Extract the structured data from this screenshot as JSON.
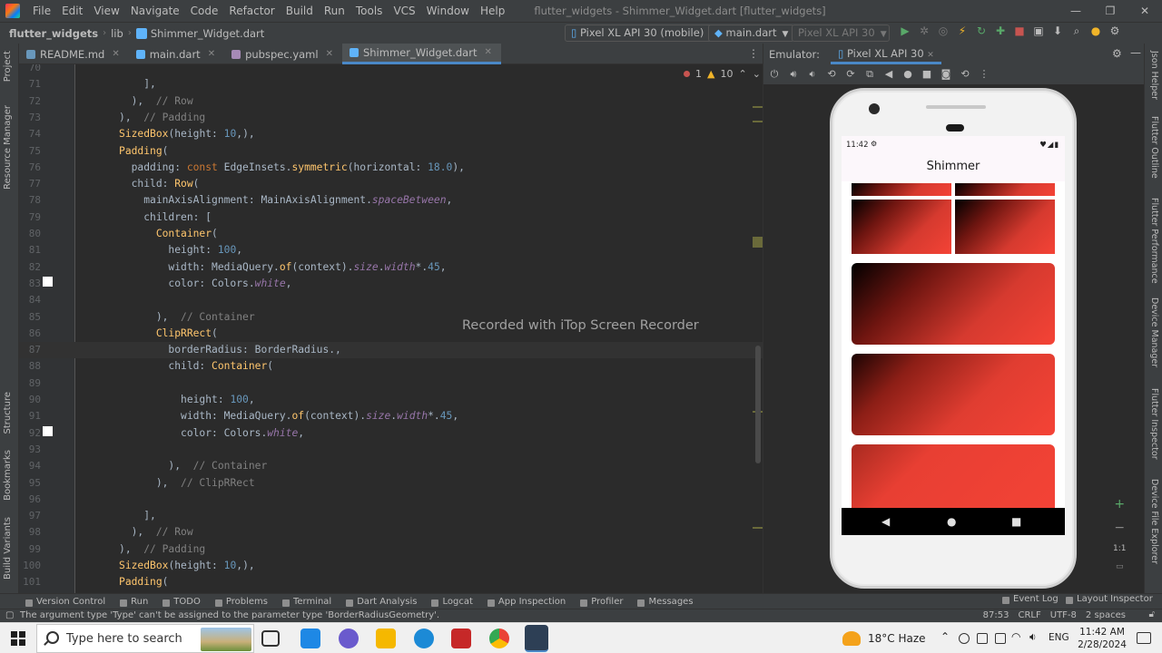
{
  "menubar": {
    "items": [
      "File",
      "Edit",
      "View",
      "Navigate",
      "Code",
      "Refactor",
      "Build",
      "Run",
      "Tools",
      "VCS",
      "Window",
      "Help"
    ],
    "window_title": "flutter_widgets - Shimmer_Widget.dart [flutter_widgets]"
  },
  "navbar": {
    "project": "flutter_widgets",
    "folder": "lib",
    "file": "Shimmer_Widget.dart",
    "device_combo": "Pixel XL API 30 (mobile)",
    "run_config": "main.dart",
    "running_device": "Pixel XL API 30"
  },
  "left_stripe": [
    "Project",
    "Resource Manager",
    "Structure",
    "Bookmarks",
    "Build Variants"
  ],
  "right_stripe": [
    "Json Helper",
    "Flutter Outline",
    "Flutter Performance",
    "Device Manager",
    "Flutter Inspector",
    "Device File Explorer"
  ],
  "editor_tabs": [
    {
      "label": "README.md",
      "color": "#6897bb"
    },
    {
      "label": "main.dart",
      "color": "#5fb3f9"
    },
    {
      "label": "pubspec.yaml",
      "color": "#a68ab6"
    },
    {
      "label": "Shimmer_Widget.dart",
      "color": "#5fb3f9"
    }
  ],
  "inspections": {
    "errors": "1",
    "warnings": "10"
  },
  "code_lines": [
    {
      "n": "70",
      "t": ""
    },
    {
      "n": "71",
      "t": "              ],"
    },
    {
      "n": "72",
      "t": "            ),  // Row"
    },
    {
      "n": "73",
      "t": "          ),  // Padding"
    },
    {
      "n": "74",
      "t": "          SizedBox(height: 10,),"
    },
    {
      "n": "75",
      "t": "          Padding("
    },
    {
      "n": "76",
      "t": "            padding: const EdgeInsets.symmetric(horizontal: 18.0),"
    },
    {
      "n": "77",
      "t": "            child: Row("
    },
    {
      "n": "78",
      "t": "              mainAxisAlignment: MainAxisAlignment.spaceBetween,"
    },
    {
      "n": "79",
      "t": "              children: ["
    },
    {
      "n": "80",
      "t": "                Container("
    },
    {
      "n": "81",
      "t": "                  height: 100,"
    },
    {
      "n": "82",
      "t": "                  width: MediaQuery.of(context).size.width*.45,"
    },
    {
      "n": "83",
      "t": "                  color: Colors.white,"
    },
    {
      "n": "84",
      "t": ""
    },
    {
      "n": "85",
      "t": "                ),  // Container"
    },
    {
      "n": "86",
      "t": "                ClipRRect("
    },
    {
      "n": "87",
      "t": "                  borderRadius: BorderRadius.,"
    },
    {
      "n": "88",
      "t": "                  child: Container("
    },
    {
      "n": "89",
      "t": ""
    },
    {
      "n": "90",
      "t": "                    height: 100,"
    },
    {
      "n": "91",
      "t": "                    width: MediaQuery.of(context).size.width*.45,"
    },
    {
      "n": "92",
      "t": "                    color: Colors.white,"
    },
    {
      "n": "93",
      "t": ""
    },
    {
      "n": "94",
      "t": "                  ),  // Container"
    },
    {
      "n": "95",
      "t": "                ),  // ClipRRect"
    },
    {
      "n": "96",
      "t": ""
    },
    {
      "n": "97",
      "t": "              ],"
    },
    {
      "n": "98",
      "t": "            ),  // Row"
    },
    {
      "n": "99",
      "t": "          ),  // Padding"
    },
    {
      "n": "100",
      "t": "          SizedBox(height: 10,),"
    },
    {
      "n": "101",
      "t": "          Padding("
    }
  ],
  "watermark": "Recorded with iTop Screen Recorder",
  "emulator": {
    "title": "Emulator:",
    "tab": "Pixel XL API 30",
    "zoom": "1:1",
    "status_time": "11:42",
    "app_title": "Shimmer",
    "gradient_colors": [
      "#000000",
      "#f44336"
    ]
  },
  "bottom_tools": [
    "Version Control",
    "Run",
    "TODO",
    "Problems",
    "Terminal",
    "Dart Analysis",
    "Logcat",
    "App Inspection",
    "Profiler",
    "Messages"
  ],
  "bottom_tools_right": [
    "Event Log",
    "Layout Inspector"
  ],
  "status": {
    "message": "The argument type 'Type' can't be assigned to the parameter type 'BorderRadiusGeometry'.",
    "position": "87:53",
    "line_sep": "CRLF",
    "encoding": "UTF-8",
    "indent": "2 spaces"
  },
  "taskbar": {
    "search_placeholder": "Type here to search",
    "weather": "18°C  Haze",
    "lang": "ENG",
    "time": "11:42 AM",
    "date": "2/28/2024"
  }
}
